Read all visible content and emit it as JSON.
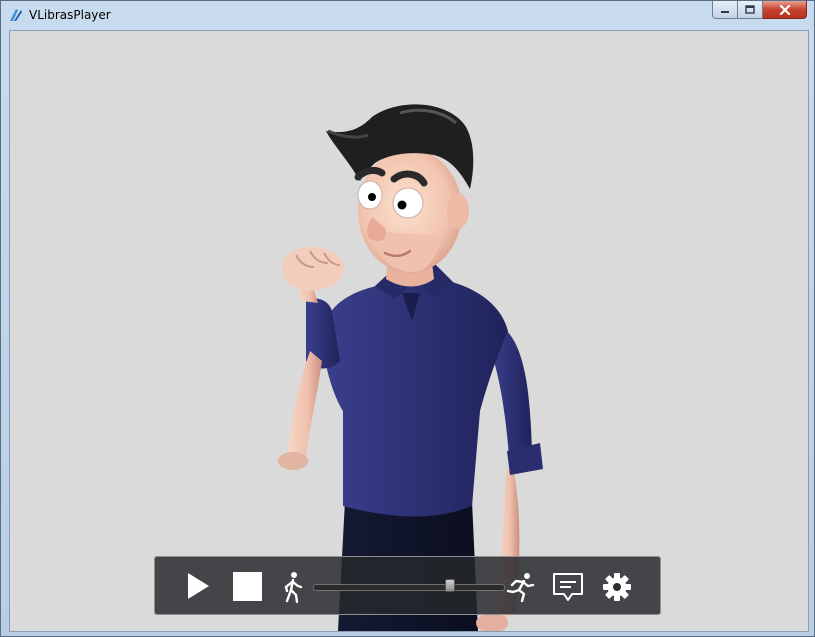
{
  "window": {
    "title": "VLibrasPlayer"
  },
  "player": {
    "speed_level": 0.72
  },
  "colors": {
    "viewport_bg": "#dadada",
    "controlbar_bg": "#26282c",
    "shirt": "#2b2e6e",
    "skin": "#f1c3b0",
    "hair": "#1f1f1f"
  },
  "icons": {
    "play": "play-icon",
    "stop": "stop-icon",
    "slow": "walk-icon",
    "fast": "run-icon",
    "subtitles": "subtitles-icon",
    "settings": "gear-icon"
  }
}
